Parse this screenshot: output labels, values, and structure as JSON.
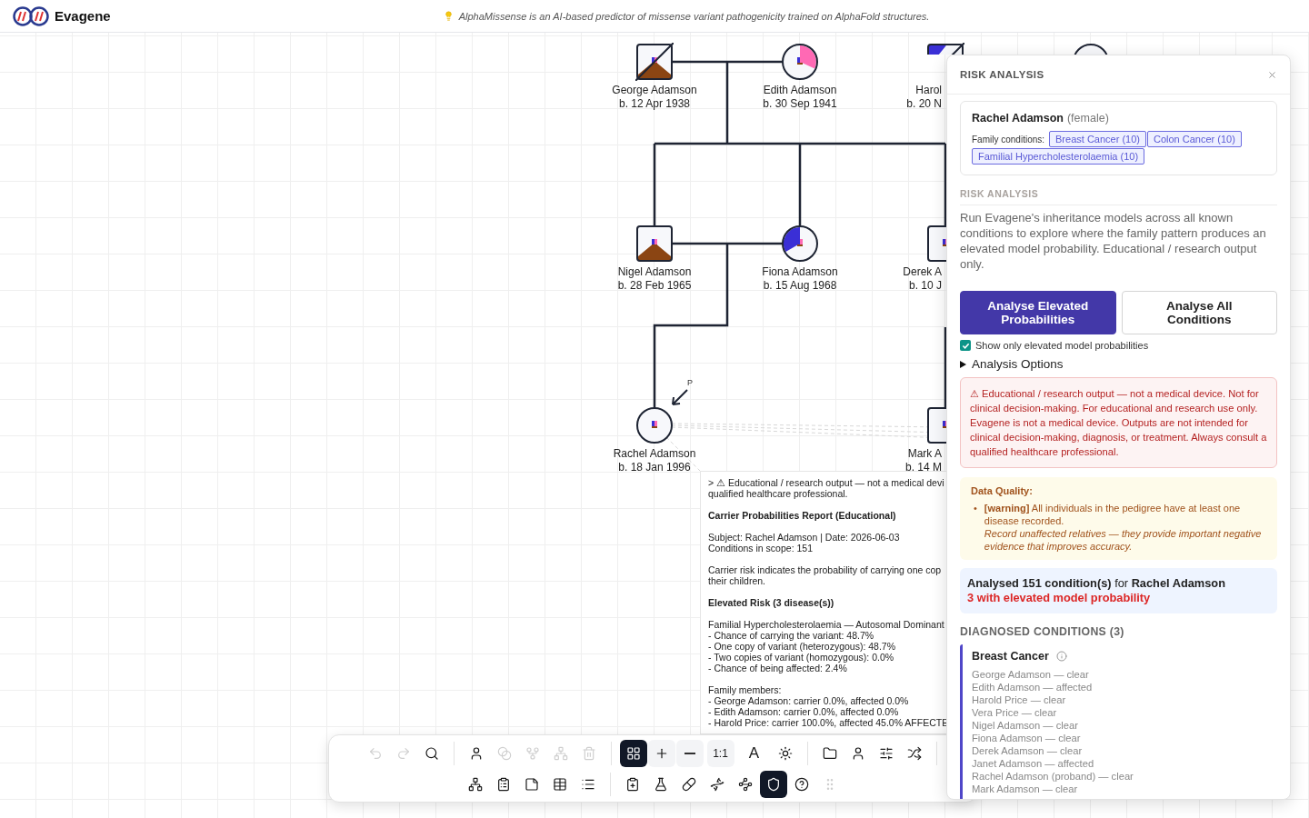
{
  "app": {
    "name": "Evagene",
    "tip": "AlphaMissense is an AI-based predictor of missense variant pathogenicity trained on AlphaFold structures."
  },
  "pedigree": {
    "individuals": [
      {
        "name": "George Adamson",
        "birth": "b. 12 Apr 1938",
        "kind": "male",
        "deceased": true,
        "shading": {
          "kind": "mountain",
          "color": "#8b4513"
        }
      },
      {
        "name": "Edith Adamson",
        "birth": "b. 30 Sep 1941",
        "kind": "female",
        "deceased": false,
        "shading": {
          "kind": "wedge-right",
          "color": "#ff69b4"
        }
      },
      {
        "name": "Harol",
        "birth": "b. 20 N",
        "kind": "male",
        "deceased": true,
        "clipped": true,
        "shading": {
          "kind": "corner",
          "color": "#3a2fd6"
        }
      },
      {
        "kind": "female",
        "deceased": false
      },
      {
        "name": "Nigel Adamson",
        "birth": "b. 28 Feb 1965",
        "kind": "male",
        "deceased": false,
        "shading": {
          "kind": "mountain",
          "color": "#8b4513"
        }
      },
      {
        "name": "Fiona Adamson",
        "birth": "b. 15 Aug 1968",
        "kind": "female",
        "deceased": false,
        "shading": {
          "kind": "wedge-left",
          "color": "#3a2fd6"
        }
      },
      {
        "name": "Derek A",
        "birth": "b. 10 J",
        "kind": "male",
        "deceased": false,
        "clipped": true
      },
      {
        "name": "Rachel Adamson",
        "birth": "b. 18 Jan 1996",
        "kind": "female",
        "deceased": false,
        "proband": "P"
      },
      {
        "name": "Mark A",
        "birth": "b. 14 M",
        "kind": "male",
        "deceased": false,
        "clipped": true
      }
    ]
  },
  "report": {
    "paragraphs": [
      {
        "bold": false,
        "lines": [
          "> ⚠ Educational / research output — not a medical devi",
          "qualified healthcare professional."
        ]
      },
      {
        "bold": true,
        "lines": [
          "Carrier Probabilities Report (Educational)"
        ]
      },
      {
        "bold": false,
        "lines": [
          "Subject: Rachel Adamson | Date: 2026-06-03",
          "Conditions in scope: 151"
        ]
      },
      {
        "bold": false,
        "lines": [
          "Carrier risk indicates the probability of carrying one cop",
          "their children."
        ]
      },
      {
        "bold": true,
        "lines": [
          "Elevated Risk (3 disease(s))"
        ]
      },
      {
        "bold": false,
        "lines": [
          "Familial Hypercholesterolaemia — Autosomal Dominant",
          "- Chance of carrying the variant: 48.7%",
          "- One copy of variant (heterozygous): 48.7%",
          "- Two copies of variant (homozygous): 0.0%",
          "- Chance of being affected: 2.4%"
        ]
      },
      {
        "bold": false,
        "lines": [
          "Family members:",
          "- George Adamson: carrier 0.0%, affected 0.0%",
          "- Edith Adamson: carrier 0.0%, affected 0.0%",
          "- Harold Price: carrier 100.0%, affected 45.0% AFFECTE"
        ]
      }
    ]
  },
  "toolbar": {
    "rows": [
      [
        {
          "kind": "tool",
          "disabled": true,
          "selected": false
        },
        {
          "kind": "tool",
          "disabled": true,
          "selected": false
        },
        {
          "kind": "tool",
          "disabled": false,
          "selected": false
        },
        {
          "kind": "separator"
        },
        {
          "kind": "tool",
          "disabled": false,
          "selected": false
        },
        {
          "kind": "tool",
          "disabled": true,
          "selected": false
        },
        {
          "kind": "tool",
          "disabled": true,
          "selected": false
        },
        {
          "kind": "tool",
          "disabled": true,
          "selected": false
        },
        {
          "kind": "tool",
          "disabled": true,
          "selected": false
        },
        {
          "kind": "separator"
        },
        {
          "kind": "tool",
          "disabled": false,
          "selected": true
        },
        {
          "kind": "tool",
          "disabled": false,
          "selected": false
        },
        {
          "kind": "tool",
          "disabled": false,
          "selected": false
        },
        {
          "kind": "text-tool",
          "label": "1:1",
          "disabled": false,
          "selected": false
        },
        {
          "kind": "text-tool",
          "label": "A",
          "disabled": false,
          "selected": false
        },
        {
          "kind": "tool",
          "disabled": false,
          "selected": false
        },
        {
          "kind": "separator"
        },
        {
          "kind": "tool",
          "disabled": false,
          "selected": false
        },
        {
          "kind": "tool",
          "disabled": false,
          "selected": false
        },
        {
          "kind": "tool",
          "disabled": false,
          "selected": false
        },
        {
          "kind": "tool",
          "disabled": false,
          "selected": false
        },
        {
          "kind": "separator"
        }
      ],
      [
        {
          "kind": "tool",
          "disabled": false,
          "selected": false
        },
        {
          "kind": "tool",
          "disabled": false,
          "selected": false
        },
        {
          "kind": "tool",
          "disabled": false,
          "selected": false
        },
        {
          "kind": "tool",
          "disabled": false,
          "selected": false
        },
        {
          "kind": "tool",
          "disabled": false,
          "selected": false
        },
        {
          "kind": "separator"
        },
        {
          "kind": "tool",
          "disabled": false,
          "selected": false
        },
        {
          "kind": "tool",
          "disabled": false,
          "selected": false
        },
        {
          "kind": "tool",
          "disabled": false,
          "selected": false
        },
        {
          "kind": "tool",
          "disabled": false,
          "selected": false
        },
        {
          "kind": "tool",
          "disabled": false,
          "selected": false
        },
        {
          "kind": "tool",
          "disabled": false,
          "selected": true
        },
        {
          "kind": "tool",
          "disabled": false,
          "selected": false
        },
        {
          "kind": "tool",
          "disabled": true,
          "selected": false
        }
      ]
    ]
  },
  "panel": {
    "title": "RISK ANALYSIS",
    "person": {
      "name": "Rachel Adamson",
      "sex_label": "(female)",
      "conditions_label": "Family conditions:",
      "conditions": [
        "Breast Cancer (10)",
        "Colon Cancer (10)",
        "Familial Hypercholesterolaemia (10)"
      ]
    },
    "section_title": "RISK ANALYSIS",
    "description": "Run Evagene's inheritance models across all known conditions to explore where the family pattern produces an elevated model probability. Educational / research output only.",
    "buttons": [
      {
        "label": "Analyse Elevated Probabilities",
        "primary": true
      },
      {
        "label": "Analyse All Conditions",
        "primary": false
      }
    ],
    "filter": {
      "label": "Show only elevated model probabilities",
      "checked": true
    },
    "options": {
      "label": "Analysis Options",
      "expanded": false
    },
    "disclaimer": "⚠ Educational / research output — not a medical device. Not for clinical decision-making. For educational and research use only. Evagene is not a medical device. Outputs are not intended for clinical decision-making, diagnosis, or treatment. Always consult a qualified healthcare professional.",
    "data_quality": {
      "title": "Data Quality:",
      "items": [
        {
          "marker": "•",
          "text": "**[warning]** All individuals in the pedigree have at least one disease recorded.",
          "hint": "Record unaffected relatives — they provide important negative evidence that improves accuracy."
        }
      ]
    },
    "summary": {
      "line": "**Analysed 151 condition(s)** for **Rachel Adamson**",
      "elevated": "3 with elevated model probability"
    },
    "diagnosed_title": "DIAGNOSED CONDITIONS (3)",
    "conditions": [
      {
        "name": "Breast Cancer",
        "members": [
          "George Adamson — clear",
          "Edith Adamson — affected",
          "Harold Price — clear",
          "Vera Price — clear",
          "Nigel Adamson — clear",
          "Fiona Adamson — clear",
          "Derek Adamson — clear",
          "Janet Adamson — affected",
          "Rachel Adamson (proband) — clear",
          "Mark Adamson — clear"
        ]
      }
    ]
  }
}
